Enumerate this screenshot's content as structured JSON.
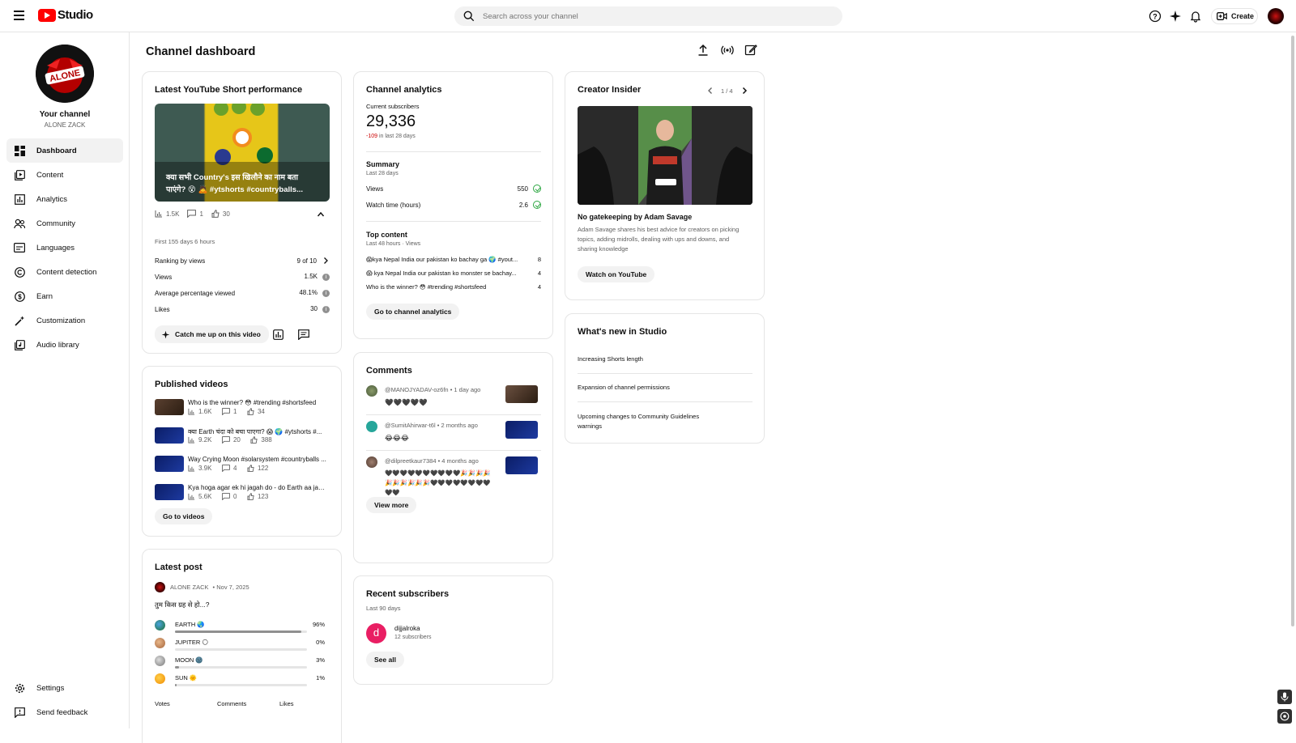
{
  "topbar": {
    "app_name": "Studio",
    "search_placeholder": "Search across your channel",
    "create_label": "Create"
  },
  "sidebar": {
    "channel_label": "Your channel",
    "channel_handle": "ALONE ZACK",
    "avatar_text": "ALONE",
    "items": [
      {
        "label": "Dashboard",
        "icon": "dashboard-icon"
      },
      {
        "label": "Content",
        "icon": "content-icon"
      },
      {
        "label": "Analytics",
        "icon": "analytics-icon"
      },
      {
        "label": "Community",
        "icon": "community-icon"
      },
      {
        "label": "Languages",
        "icon": "languages-icon"
      },
      {
        "label": "Content detection",
        "icon": "copyright-icon"
      },
      {
        "label": "Earn",
        "icon": "earn-icon"
      },
      {
        "label": "Customization",
        "icon": "customization-icon"
      },
      {
        "label": "Audio library",
        "icon": "audio-library-icon"
      }
    ],
    "bottom_items": [
      {
        "label": "Settings",
        "icon": "gear-icon"
      },
      {
        "label": "Send feedback",
        "icon": "feedback-icon"
      }
    ]
  },
  "page": {
    "title": "Channel dashboard"
  },
  "short_card": {
    "title": "Latest YouTube Short performance",
    "thumb_caption": "क्या सभी Country's इस खिलौने का नाम बता पाएंगे? 😵 🙇 #ytshorts #countryballs...",
    "views": "1.5K",
    "comments": "1",
    "likes": "30",
    "period": "First 155 days 6 hours",
    "metrics": [
      {
        "label": "Ranking by views",
        "value": "9 of 10"
      },
      {
        "label": "Views",
        "value": "1.5K"
      },
      {
        "label": "Average percentage viewed",
        "value": "48.1%"
      },
      {
        "label": "Likes",
        "value": "30"
      }
    ],
    "catch_up_label": "Catch me up on this video"
  },
  "analytics_card": {
    "title": "Channel analytics",
    "subs_label": "Current subscribers",
    "subs_value": "29,336",
    "subs_change": "-109",
    "subs_change_suffix": "in last 28 days",
    "summary_title": "Summary",
    "summary_period": "Last 28 days",
    "summary_rows": [
      {
        "label": "Views",
        "value": "550"
      },
      {
        "label": "Watch time (hours)",
        "value": "2.6"
      }
    ],
    "top_title": "Top content",
    "top_period": "Last 48 hours · Views",
    "top_rows": [
      {
        "label": "😱kya Nepal India our pakistan ko bachay ga 🌍 #yout...",
        "value": "8"
      },
      {
        "label": "😱 kya Nepal India our pakistan ko monster se bachay...",
        "value": "4"
      },
      {
        "label": "Who is the winner? 😳 #trending #shortsfeed",
        "value": "4"
      }
    ],
    "button_label": "Go to channel analytics"
  },
  "insider_card": {
    "title": "Creator Insider",
    "pager": "1 / 4",
    "video_title": "No gatekeeping by Adam Savage",
    "description": "Adam Savage shares his best advice for creators on picking topics, adding midrolls, dealing with ups and downs, and sharing knowledge",
    "button_label": "Watch on YouTube"
  },
  "whats_new_card": {
    "title": "What's new in Studio",
    "items": [
      "Increasing Shorts length",
      "Expansion of channel permissions",
      "Upcoming changes to Community Guidelines warnings"
    ]
  },
  "published_card": {
    "title": "Published videos",
    "videos": [
      {
        "title": "Who is the winner? 😳 #trending #shortsfeed",
        "views": "1.6K",
        "comments": "1",
        "likes": "34"
      },
      {
        "title": "क्या Earth चंदा को बचा पाएगा? 😱 🌍 #ytshorts #...",
        "views": "9.2K",
        "comments": "20",
        "likes": "388"
      },
      {
        "title": "Way Crying Moon #solarsystem #countryballs ...",
        "views": "3.9K",
        "comments": "4",
        "likes": "122"
      },
      {
        "title": "Kya hoga agar ek hi jagah do - do Earth aa jay ...",
        "views": "5.6K",
        "comments": "0",
        "likes": "123"
      }
    ],
    "button_label": "Go to videos"
  },
  "comments_card": {
    "title": "Comments",
    "comments": [
      {
        "user": "@MANOJYADAV-oz6fn",
        "time": "• 1 day ago",
        "text": "🖤🖤🖤🖤🖤"
      },
      {
        "user": "@SumitAhirwar-t6l",
        "time": "• 2 months ago",
        "text": "😂😂😂"
      },
      {
        "user": "@dilpreetkaur7384",
        "time": "• 4 months ago",
        "text": "🖤🖤🖤🖤🖤🖤🖤🖤🖤🖤🎉🎉🎉🎉🎉🎉🎉🎉🎉🎉🖤🖤🖤🖤🖤🖤🖤🖤🖤🖤"
      }
    ],
    "button_label": "View more"
  },
  "subscribers_card": {
    "title": "Recent subscribers",
    "period": "Last 90 days",
    "subscriber": {
      "initial": "d",
      "name": "dijjalroka",
      "count": "12 subscribers"
    },
    "button_label": "See all"
  },
  "post_card": {
    "title": "Latest post",
    "author": "ALONE ZACK",
    "date": "• Nov 7, 2025",
    "question": "तुम किस ग्रह से हो...?",
    "options": [
      {
        "label": "EARTH 🌏",
        "pct": "96%",
        "fill": 0.96
      },
      {
        "label": "JUPITER 🌕",
        "pct": "0%",
        "fill": 0
      },
      {
        "label": "MOON 🌚",
        "pct": "3%",
        "fill": 0.03
      },
      {
        "label": "SUN 🌞",
        "pct": "1%",
        "fill": 0.01
      }
    ],
    "footer": [
      "Votes",
      "Comments",
      "Likes"
    ]
  },
  "colors": {
    "accent_red": "#ff0000",
    "negative": "#cc0000",
    "positive": "#2ba640",
    "sub_avatar": "#e91e63"
  }
}
